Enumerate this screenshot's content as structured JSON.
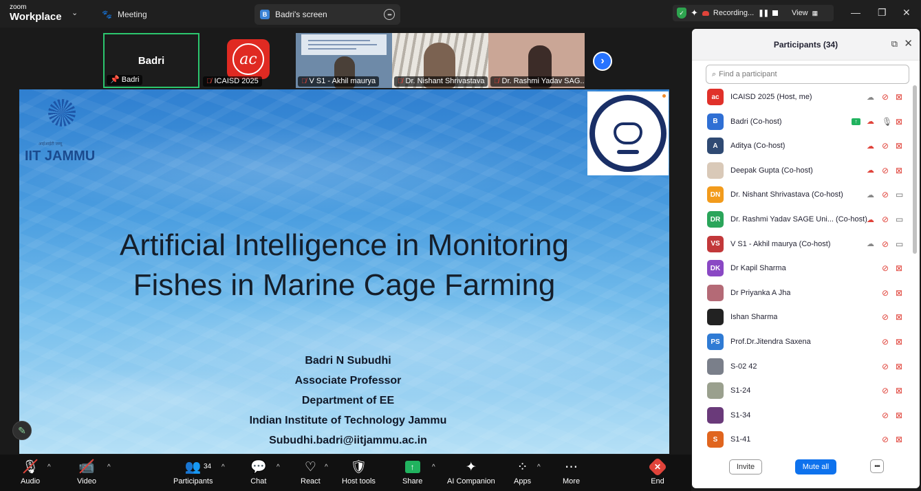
{
  "app": {
    "brand_small": "zoom",
    "brand_big": "Workplace",
    "meeting_tab": "Meeting",
    "screen_tab": "Badri's screen",
    "screen_tab_badge": "B",
    "recording_label": "Recording...",
    "view_label": "View"
  },
  "tiles": [
    {
      "label": "Badri",
      "display": "Badri"
    },
    {
      "label": "ICAISD 2025"
    },
    {
      "label": "V S1 - Akhil maurya"
    },
    {
      "label": "Dr. Nishant Shrivastava"
    },
    {
      "label": "Dr. Rashmi Yadav SAG..."
    }
  ],
  "slide": {
    "logo_left_text": "IIT JAMMU",
    "logo_left_hindi": "आईआईटी जम्मू",
    "title_line1": "Artificial Intelligence in Monitoring",
    "title_line2": "Fishes in Marine Cage Farming",
    "author": [
      "Badri N Subudhi",
      "Associate Professor",
      "Department of EE",
      "Indian Institute of Technology Jammu",
      "Subudhi.badri@iitjammu.ac.in"
    ]
  },
  "toolbar": {
    "audio": "Audio",
    "video": "Video",
    "participants": "Participants",
    "participants_count": "34",
    "chat": "Chat",
    "react": "React",
    "host_tools": "Host tools",
    "share": "Share",
    "ai_companion": "AI Companion",
    "apps": "Apps",
    "more": "More",
    "end": "End"
  },
  "panel": {
    "title": "Participants (34)",
    "search_placeholder": "Find a participant",
    "invite": "Invite",
    "mute_all": "Mute all",
    "participants": [
      {
        "name": "ICAISD 2025 (Host, me)",
        "initials": "ac",
        "color": "#e0312a",
        "cloud": "grey",
        "mic": "off",
        "cam": "off"
      },
      {
        "name": "Badri (Co-host)",
        "initials": "B",
        "color": "#2f6fd4",
        "cloud": "red",
        "mic": "on",
        "cam": "off",
        "sharing": true
      },
      {
        "name": "Aditya (Co-host)",
        "initials": "A",
        "color": "#2f4a73",
        "cloud": "red",
        "mic": "off",
        "cam": "off"
      },
      {
        "name": "Deepak Gupta (Co-host)",
        "initials": "",
        "color": "#d9c9b8",
        "cloud": "red",
        "mic": "off",
        "cam": "off"
      },
      {
        "name": "Dr. Nishant Shrivastava (Co-host)",
        "initials": "DN",
        "color": "#f29b1c",
        "cloud": "grey",
        "mic": "off",
        "cam": "on"
      },
      {
        "name": "Dr. Rashmi Yadav SAGE Uni...  (Co-host)",
        "initials": "DR",
        "color": "#2aa55a",
        "cloud": "red",
        "mic": "off",
        "cam": "on"
      },
      {
        "name": "V S1 - Akhil maurya (Co-host)",
        "initials": "VS",
        "color": "#c2383a",
        "cloud": "grey",
        "mic": "off",
        "cam": "on"
      },
      {
        "name": "Dr Kapil Sharma",
        "initials": "DK",
        "color": "#8a48c4",
        "cloud": "",
        "mic": "off",
        "cam": "off"
      },
      {
        "name": "Dr Priyanka A Jha",
        "initials": "",
        "color": "#b46a76",
        "cloud": "",
        "mic": "off",
        "cam": "off"
      },
      {
        "name": "Ishan Sharma",
        "initials": "",
        "color": "#222222",
        "cloud": "",
        "mic": "off",
        "cam": "off"
      },
      {
        "name": "Prof.Dr.Jitendra Saxena",
        "initials": "PS",
        "color": "#2f7bd4",
        "cloud": "",
        "mic": "off",
        "cam": "off"
      },
      {
        "name": "S-02 42",
        "initials": "",
        "color": "#7a7f8a",
        "cloud": "",
        "mic": "off",
        "cam": "off"
      },
      {
        "name": "S1-24",
        "initials": "",
        "color": "#9aa08e",
        "cloud": "",
        "mic": "off",
        "cam": "off"
      },
      {
        "name": "S1-34",
        "initials": "",
        "color": "#6a3a7a",
        "cloud": "",
        "mic": "off",
        "cam": "off"
      },
      {
        "name": "S1-41",
        "initials": "S",
        "color": "#e0651e",
        "cloud": "",
        "mic": "off",
        "cam": "off"
      }
    ]
  }
}
